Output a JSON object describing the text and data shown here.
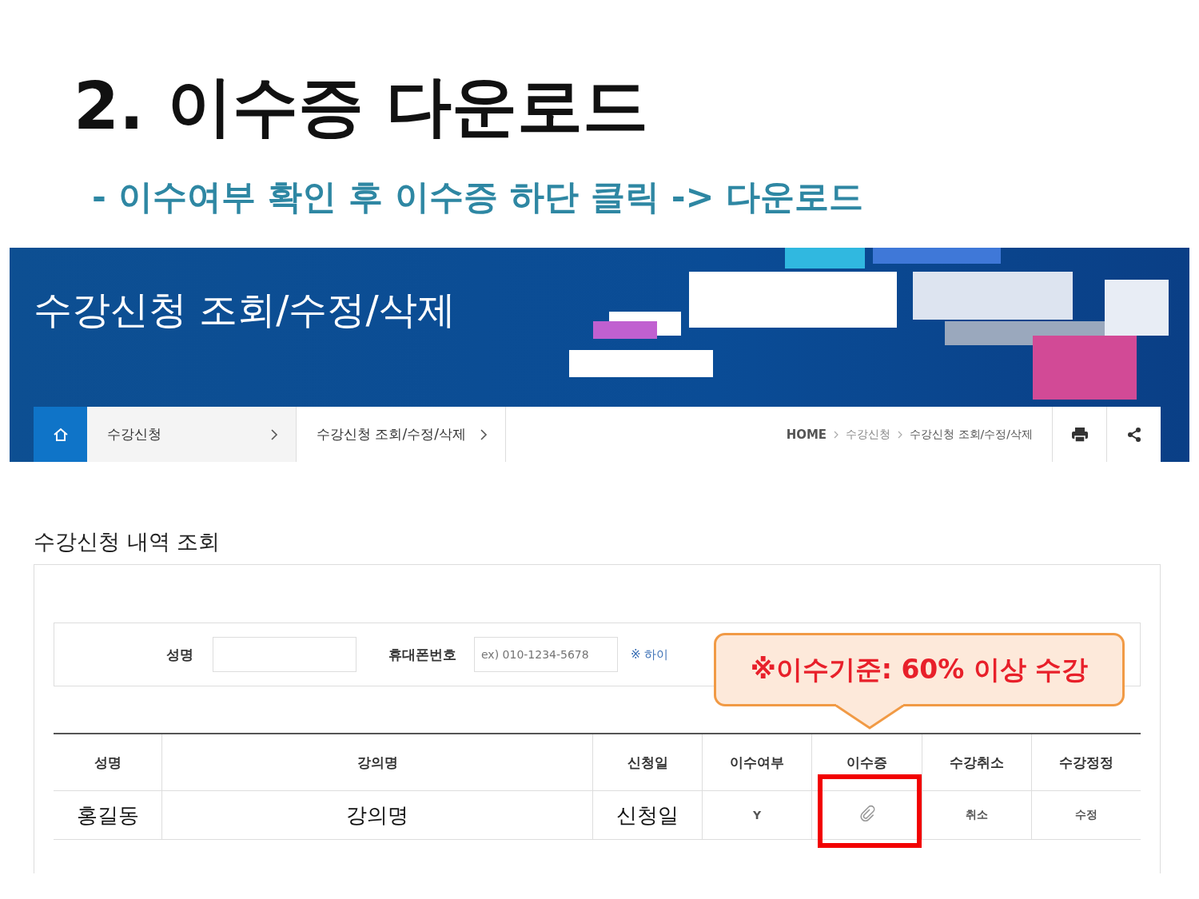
{
  "slide": {
    "title": "2. 이수증 다운로드",
    "subtitle": "- 이수여부 확인 후 이수증 하단 클릭 -> 다운로드"
  },
  "banner": {
    "title": "수강신청 조회/수정/삭제"
  },
  "breadcrumb": {
    "menus": [
      {
        "label": "수강신청"
      },
      {
        "label": "수강신청 조회/수정/삭제"
      }
    ],
    "path": [
      "HOME",
      "수강신청",
      "수강신청 조회/수정/삭제"
    ]
  },
  "section_title": "수강신청 내역 조회",
  "search_form": {
    "fields": [
      {
        "label": "성명"
      },
      {
        "label": "휴대폰번호",
        "placeholder": "ex) 010-1234-5678"
      }
    ],
    "note": "※ 하이"
  },
  "table": {
    "columns": [
      "성명",
      "강의명",
      "신청일",
      "이수여부",
      "이수증",
      "수강취소",
      "수강정정"
    ],
    "rows": [
      {
        "name": "홍길동",
        "course": "강의명",
        "date": "신청일",
        "completed": "Y",
        "cancel": "취소",
        "edit": "수정"
      }
    ]
  },
  "callout": {
    "text": "※이수기준: 60% 이상 수강"
  }
}
